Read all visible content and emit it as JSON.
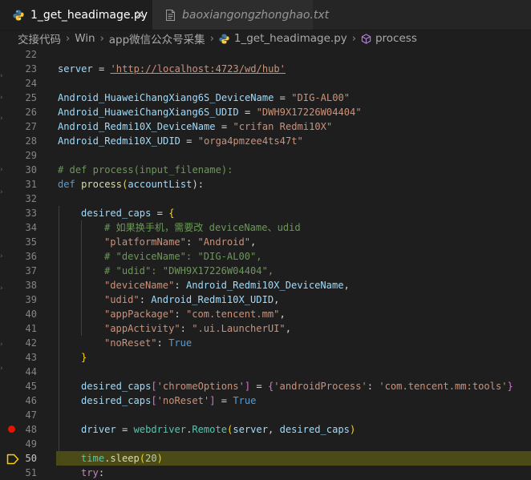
{
  "tabs": [
    {
      "label": "1_get_headimage.py",
      "icon": "python-icon",
      "active": true,
      "close": "×"
    },
    {
      "label": "baoxiangongzhonghao.txt",
      "icon": "text-file-icon",
      "active": false
    }
  ],
  "breadcrumb": [
    "交接代码",
    "Win",
    "app微信公众号采集",
    "1_get_headimage.py",
    "process"
  ],
  "breadcrumb_separator": "›",
  "line_numbers": [
    "22",
    "23",
    "24",
    "25",
    "26",
    "27",
    "28",
    "29",
    "30",
    "31",
    "32",
    "33",
    "34",
    "35",
    "36",
    "37",
    "38",
    "39",
    "40",
    "41",
    "42",
    "43",
    "44",
    "45",
    "46",
    "47",
    "48",
    "49",
    "50",
    "51"
  ],
  "current_line": "50",
  "breakpoint_line": "48",
  "code": {
    "l23": {
      "v": "server",
      "eq": " = ",
      "s": "'http://localhost:4723/wd/hub'"
    },
    "l25": {
      "v": "Android_HuaweiChangXiang6S_DeviceName",
      "eq": " = ",
      "s": "\"DIG-AL00\""
    },
    "l26": {
      "v": "Android_HuaweiChangXiang6S_UDID",
      "eq": " = ",
      "s": "\"DWH9X17226W04404\""
    },
    "l27": {
      "v": "Android_Redmi10X_DeviceName",
      "eq": " = ",
      "s": "\"crifan Redmi10X\""
    },
    "l28": {
      "v": "Android_Redmi10X_UDID",
      "eq": " = ",
      "s": "\"orga4pmzee4ts47t\""
    },
    "l30": {
      "c": "# def process(input_filename):"
    },
    "l31": {
      "k": "def",
      "f": "process",
      "p": "accountList",
      "end": "):"
    },
    "l33": {
      "v": "desired_caps",
      "eq": " = ",
      "b": "{"
    },
    "l34": {
      "c": "# 如果换手机，需要改 deviceName、udid"
    },
    "l35": {
      "s": "\"platformName\"",
      "colon": ": ",
      "s2": "\"Android\"",
      "comma": ","
    },
    "l36": {
      "c": "# \"deviceName\": \"DIG-AL00\","
    },
    "l37": {
      "c": "# \"udid\": \"DWH9X17226W04404\","
    },
    "l38": {
      "s": "\"deviceName\"",
      "colon": ": ",
      "v": "Android_Redmi10X_DeviceName",
      "comma": ","
    },
    "l39": {
      "s": "\"udid\"",
      "colon": ": ",
      "v": "Android_Redmi10X_UDID",
      "comma": ","
    },
    "l40": {
      "s": "\"appPackage\"",
      "colon": ": ",
      "s2": "\"com.tencent.mm\"",
      "comma": ","
    },
    "l41": {
      "s": "\"appActivity\"",
      "colon": ": ",
      "s2": "\".ui.LauncherUI\"",
      "comma": ","
    },
    "l42": {
      "s": "\"noReset\"",
      "colon": ": ",
      "k": "True"
    },
    "l43": {
      "b": "}"
    },
    "l45": {
      "v": "desired_caps",
      "lb": "[",
      "s": "'chromeOptions'",
      "rb": "]",
      "eq": " = ",
      "b1": "{",
      "s2": "'androidProcess'",
      "colon": ": ",
      "s3": "'com.tencent.mm:tools'",
      "b2": "}"
    },
    "l46": {
      "v": "desired_caps",
      "lb": "[",
      "s": "'noReset'",
      "rb": "]",
      "eq": " = ",
      "k": "True"
    },
    "l48": {
      "v": "driver",
      "eq": " = ",
      "m": "webdriver",
      "dot": ".",
      "f": "Remote",
      "lp": "(",
      "a1": "server",
      "sep": ", ",
      "a2": "desired_caps",
      "rp": ")"
    },
    "l50": {
      "m": "time",
      "dot": ".",
      "f": "sleep",
      "lp": "(",
      "n": "20",
      "rp": ")"
    },
    "l51": {
      "k": "try",
      "end": ":"
    }
  },
  "colors": {
    "background": "#1e1e1e",
    "current_line_highlight": "#4b4b18",
    "breakpoint": "#e51400",
    "debug_arrow": "#ffcc00"
  }
}
